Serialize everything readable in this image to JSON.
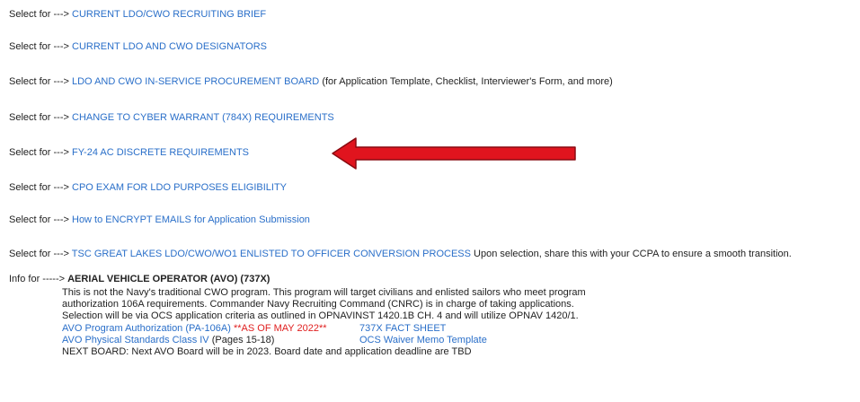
{
  "select_prefix": "Select for --->",
  "rows": [
    {
      "link": "CURRENT LDO/CWO RECRUITING BRIEF",
      "note": ""
    },
    {
      "link": "CURRENT LDO AND CWO DESIGNATORS",
      "note": ""
    },
    {
      "link": "LDO AND CWO IN-SERVICE PROCUREMENT BOARD",
      "note": "(for Application Template, Checklist, Interviewer's Form, and more)"
    },
    {
      "link": "CHANGE TO CYBER WARRANT (784X) REQUIREMENTS",
      "note": ""
    },
    {
      "link": "FY-24 AC DISCRETE REQUIREMENTS",
      "note": ""
    },
    {
      "link": "CPO EXAM FOR LDO PURPOSES ELIGIBILITY",
      "note": ""
    },
    {
      "link": "How to ENCRYPT EMAILS for Application Submission",
      "note": ""
    },
    {
      "link": "TSC GREAT LAKES LDO/CWO/WO1 ENLISTED TO OFFICER CONVERSION PROCESS",
      "note": "Upon selection, share this with your CCPA to ensure a smooth transition."
    }
  ],
  "avo": {
    "prefix": "Info for ----->",
    "title": "AERIAL VEHICLE OPERATOR (AVO) (737X)",
    "desc1": "This is not the Navy's traditional CWO program. This program will target civilians and enlisted sailors who meet program",
    "desc2": "authorization 106A requirements. Commander Navy Recruiting Command (CNRC) is in charge of taking applications.",
    "desc3": "Selection will be via OCS application criteria as outlined in OPNAVINST 1420.1B CH. 4 and will utilize OPNAV 1420/1.",
    "link_auth": "AVO Program Authorization (PA-106A)",
    "auth_red": "**AS OF MAY 2022**",
    "link_fact": "737X FACT SHEET",
    "link_phys": "AVO Physical Standards Class IV",
    "phys_note": "(Pages 15-18)",
    "link_waiver": "OCS Waiver Memo Template",
    "next_board": "NEXT BOARD: Next AVO Board will be in 2023. Board date and application deadline are TBD"
  },
  "colors": {
    "link": "#2a6fc9",
    "arrow": "#e0141e",
    "highlight": "#e02020"
  },
  "icons": {
    "arrow": "red-left-arrow-icon"
  }
}
